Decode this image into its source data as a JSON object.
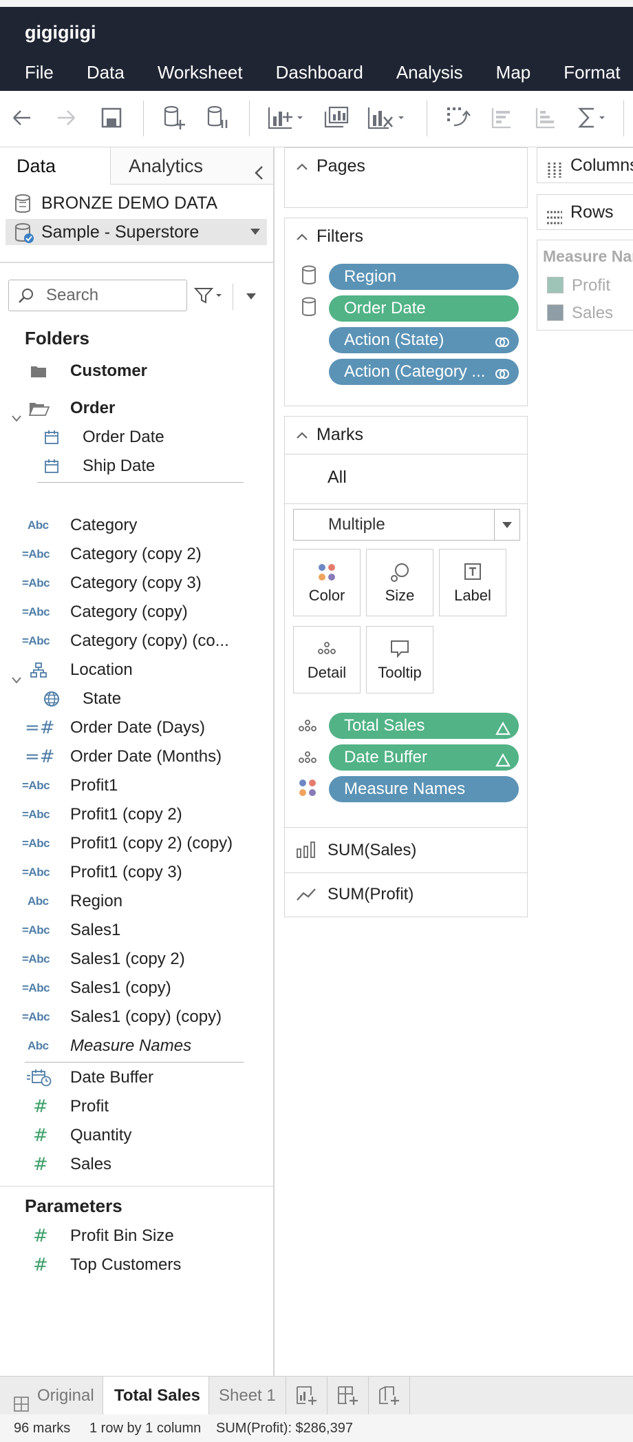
{
  "app": {
    "title": "gigigiigi"
  },
  "menu": [
    "File",
    "Data",
    "Worksheet",
    "Dashboard",
    "Analysis",
    "Map",
    "Format"
  ],
  "toolbar": {
    "icons": [
      "back-icon",
      "forward-icon",
      "save-icon",
      "new-data-source-icon",
      "pause-updates-icon",
      "new-worksheet-icon",
      "duplicate-sheet-icon",
      "clear-sheet-icon",
      "swap-rows-columns-icon",
      "sort-ascending-icon",
      "sort-descending-icon",
      "totals-icon"
    ]
  },
  "data_pane": {
    "tabs": {
      "data": "Data",
      "analytics": "Analytics"
    },
    "data_sources": [
      "BRONZE DEMO DATA",
      "Sample - Superstore"
    ],
    "search": {
      "placeholder": "Search",
      "value": ""
    },
    "folders_title": "Folders",
    "folders": [
      {
        "label": "Customer",
        "icon": "folder-icon"
      },
      {
        "label": "Order",
        "icon": "folder-open-icon"
      },
      {
        "label": "Order Date",
        "icon": "calendar-icon"
      },
      {
        "label": "Ship Date",
        "icon": "calendar-icon"
      }
    ],
    "dimensions": [
      {
        "label": "Category",
        "icon": "Abc"
      },
      {
        "label": "Category (copy 2)",
        "icon": "=Abc"
      },
      {
        "label": "Category (copy 3)",
        "icon": "=Abc"
      },
      {
        "label": "Category (copy)",
        "icon": "=Abc"
      },
      {
        "label": "Category (copy) (co...",
        "icon": "=Abc"
      },
      {
        "label": "Location",
        "icon": "hierarchy-icon"
      },
      {
        "label": "State",
        "icon": "globe-icon"
      },
      {
        "label": "Order Date (Days)",
        "icon": "=#"
      },
      {
        "label": "Order Date (Months)",
        "icon": "=#"
      },
      {
        "label": "Profit1",
        "icon": "=Abc"
      },
      {
        "label": "Profit1 (copy 2)",
        "icon": "=Abc"
      },
      {
        "label": "Profit1 (copy 2) (copy)",
        "icon": "=Abc"
      },
      {
        "label": "Profit1 (copy 3)",
        "icon": "=Abc"
      },
      {
        "label": "Region",
        "icon": "Abc"
      },
      {
        "label": "Sales1",
        "icon": "=Abc"
      },
      {
        "label": "Sales1 (copy 2)",
        "icon": "=Abc"
      },
      {
        "label": "Sales1 (copy)",
        "icon": "=Abc"
      },
      {
        "label": "Sales1 (copy) (copy)",
        "icon": "=Abc"
      },
      {
        "label": "Measure Names",
        "icon": "Abc"
      }
    ],
    "measures": [
      {
        "label": "Date Buffer",
        "icon": "calc-date-icon"
      },
      {
        "label": "Profit",
        "icon": "#"
      },
      {
        "label": "Quantity",
        "icon": "#"
      },
      {
        "label": "Sales",
        "icon": "#"
      }
    ],
    "parameters_title": "Parameters",
    "parameters": [
      {
        "label": "Profit Bin Size",
        "icon": "#"
      },
      {
        "label": "Top Customers",
        "icon": "#"
      }
    ]
  },
  "pages": {
    "title": "Pages"
  },
  "filters": {
    "title": "Filters",
    "pills": [
      "Region",
      "Order Date",
      "Action (State)",
      "Action (Category ..."
    ]
  },
  "marks": {
    "title": "Marks",
    "all_label": "All",
    "mark_type": "Multiple",
    "buttons": [
      "Color",
      "Size",
      "Label",
      "Detail",
      "Tooltip"
    ],
    "pills": [
      "Total Sales",
      "Date Buffer",
      "Measure Names"
    ],
    "measures": [
      "SUM(Sales)",
      "SUM(Profit)"
    ]
  },
  "shelves": {
    "columns": "Columns",
    "rows": "Rows"
  },
  "legend": {
    "title": "Measure Names",
    "items": [
      {
        "label": "Profit",
        "color": "#9ec4b8"
      },
      {
        "label": "Sales",
        "color": "#8e9da6"
      }
    ]
  },
  "sheet_tabs": [
    "Original",
    "Total Sales",
    "Sheet 1"
  ],
  "status": {
    "marks": "96 marks",
    "dims": "1 row by 1 column",
    "sum": "SUM(Profit): $286,397"
  },
  "colors": {
    "titlebar": "#1f2533",
    "pill_blue": "#5b93b6",
    "pill_green": "#52b386"
  }
}
